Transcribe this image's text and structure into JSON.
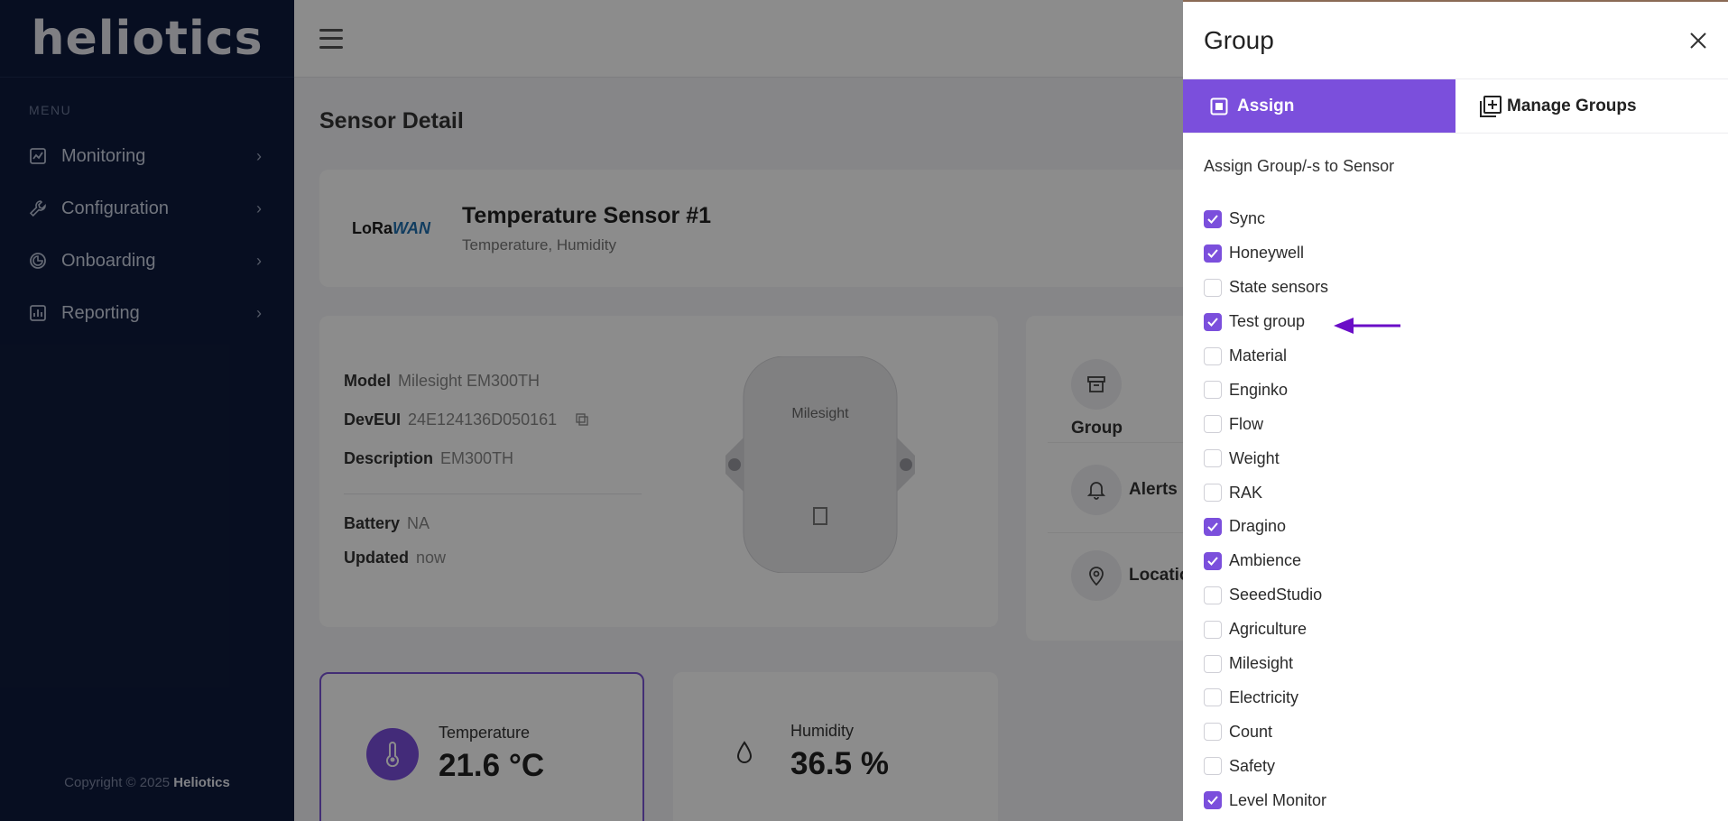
{
  "sidebar": {
    "logo": "heliotics",
    "menu_title": "MENU",
    "items": [
      {
        "label": "Monitoring",
        "icon": "chart-icon"
      },
      {
        "label": "Configuration",
        "icon": "wrench-icon"
      },
      {
        "label": "Onboarding",
        "icon": "onboarding-icon"
      },
      {
        "label": "Reporting",
        "icon": "report-icon"
      }
    ],
    "copyright_prefix": "Copyright © 2025",
    "copyright_brand": "Heliotics"
  },
  "main": {
    "page_title": "Sensor Detail",
    "sensor": {
      "protocol_logo_a": "LoRa",
      "protocol_logo_b": "WAN",
      "name": "Temperature Sensor #1",
      "subtitle": "Temperature, Humidity"
    },
    "info": {
      "model_label": "Model",
      "model_value": "Milesight EM300TH",
      "deveui_label": "DevEUI",
      "deveui_value": "24E124136D050161",
      "description_label": "Description",
      "description_value": "EM300TH",
      "battery_label": "Battery",
      "battery_value": "NA",
      "updated_label": "Updated",
      "updated_value": "now"
    },
    "device_brand": "Milesight",
    "side_actions": {
      "group": "Group",
      "alerts": "Alerts",
      "location": "Locatio"
    },
    "metrics": {
      "temperature_label": "Temperature",
      "temperature_value": "21.6 °C",
      "humidity_label": "Humidity",
      "humidity_value": "36.5 %"
    }
  },
  "drawer": {
    "title": "Group",
    "tabs": {
      "assign": "Assign",
      "manage": "Manage Groups"
    },
    "assign_title": "Assign Group/-s to Sensor",
    "groups": [
      {
        "label": "Sync",
        "checked": true
      },
      {
        "label": "Honeywell",
        "checked": true
      },
      {
        "label": "State sensors",
        "checked": false
      },
      {
        "label": "Test group",
        "checked": true
      },
      {
        "label": "Material",
        "checked": false
      },
      {
        "label": "Enginko",
        "checked": false
      },
      {
        "label": "Flow",
        "checked": false
      },
      {
        "label": "Weight",
        "checked": false
      },
      {
        "label": "RAK",
        "checked": false
      },
      {
        "label": "Dragino",
        "checked": true
      },
      {
        "label": "Ambience",
        "checked": true
      },
      {
        "label": "SeeedStudio",
        "checked": false
      },
      {
        "label": "Agriculture",
        "checked": false
      },
      {
        "label": "Milesight",
        "checked": false
      },
      {
        "label": "Electricity",
        "checked": false
      },
      {
        "label": "Count",
        "checked": false
      },
      {
        "label": "Safety",
        "checked": false
      },
      {
        "label": "Level Monitor",
        "checked": true
      }
    ]
  },
  "colors": {
    "sidebar_bg": "#0e1b3d",
    "accent": "#7b4fdc",
    "arrow": "#6a0dc7"
  }
}
